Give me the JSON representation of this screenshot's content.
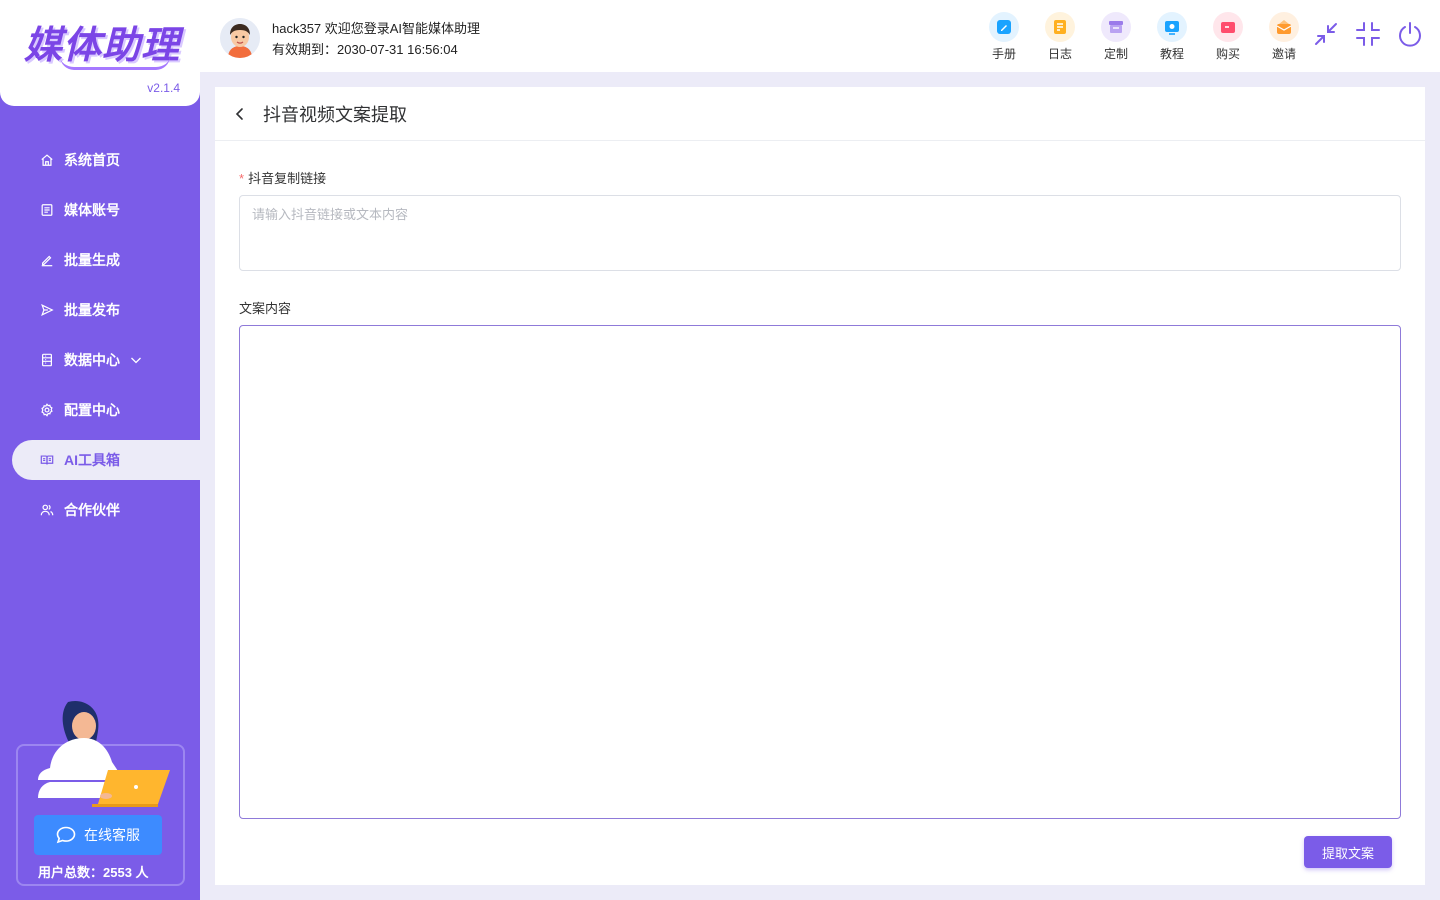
{
  "app": {
    "logo_text": "媒体助理",
    "version": "v2.1.4"
  },
  "sidebar": {
    "items": [
      {
        "label": "系统首页",
        "icon": "home-icon"
      },
      {
        "label": "媒体账号",
        "icon": "account-icon"
      },
      {
        "label": "批量生成",
        "icon": "edit-icon"
      },
      {
        "label": "批量发布",
        "icon": "send-icon"
      },
      {
        "label": "数据中心",
        "icon": "data-icon"
      },
      {
        "label": "配置中心",
        "icon": "gear-icon"
      },
      {
        "label": "AI工具箱",
        "icon": "book-icon",
        "active": true
      },
      {
        "label": "合作伙伴",
        "icon": "partner-icon"
      }
    ],
    "support_button": "在线客服",
    "user_total": "用户总数：2553 人"
  },
  "header": {
    "welcome": "hack357 欢迎您登录AI智能媒体助理",
    "expire": "有效期到：2030-07-31 16:56:04",
    "tools": [
      {
        "label": "手册",
        "color": "#1aa3ff",
        "bg": "#e3f3ff"
      },
      {
        "label": "日志",
        "color": "#ffb020",
        "bg": "#fff3dd"
      },
      {
        "label": "定制",
        "color": "#9b7bea",
        "bg": "#efe9fc"
      },
      {
        "label": "教程",
        "color": "#1aa3ff",
        "bg": "#e3f3ff"
      },
      {
        "label": "购买",
        "color": "#ff4d6d",
        "bg": "#ffe6eb"
      },
      {
        "label": "邀请",
        "color": "#ff9a2e",
        "bg": "#fff0e0"
      }
    ],
    "accent": "#7b5ce8"
  },
  "main": {
    "title": "抖音视频文案提取",
    "field1_label": "抖音复制链接",
    "field1_required": "*",
    "field1_placeholder": "请输入抖音链接或文本内容",
    "field1_value": "",
    "field2_label": "文案内容",
    "field2_value": "",
    "submit_label": "提取文案"
  }
}
